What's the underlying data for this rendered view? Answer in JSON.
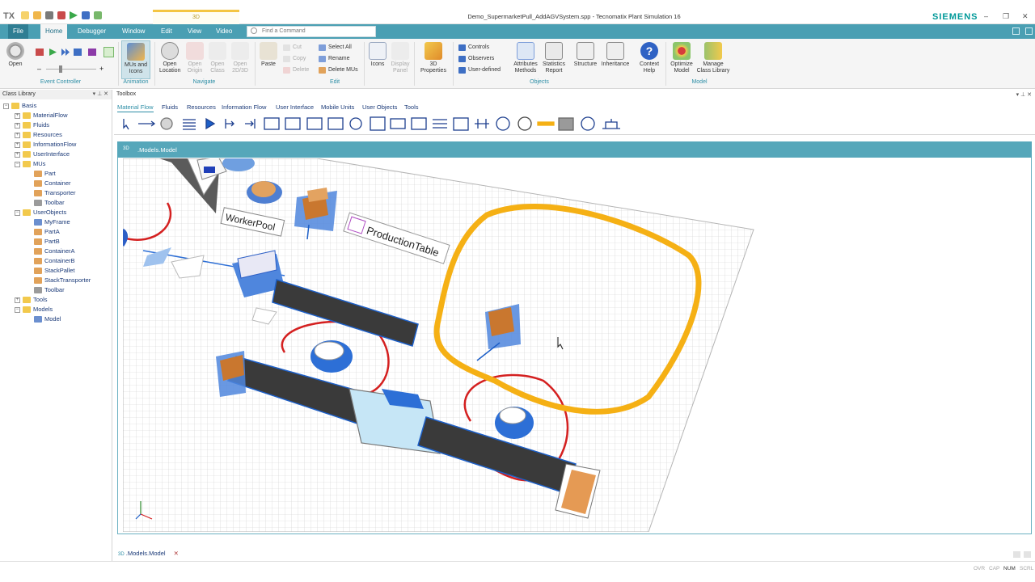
{
  "app": {
    "logo": "TX",
    "context_tab": "3D",
    "window_title": "Demo_SupermarketPull_AddAGVSystem.spp - Tecnomatix Plant Simulation 16",
    "brand": "SIEMENS",
    "minimize": "–",
    "restore": "❐",
    "close": "✕"
  },
  "tabs": [
    "File",
    "Home",
    "Debugger",
    "Window",
    "Edit",
    "View",
    "Video"
  ],
  "command_search": {
    "placeholder": "Find a Command"
  },
  "ribbon": {
    "event_controller": {
      "label": "Event Controller",
      "open": "Open",
      "minus": "–",
      "plus": "+"
    },
    "animation": {
      "label": "Animation",
      "mus_icons": "MUs and Icons"
    },
    "navigate": {
      "label": "Navigate",
      "open_location": "Open Location",
      "open_origin": "Open Origin",
      "open_class": "Open Class",
      "open_2d3d": "Open 2D/3D"
    },
    "edit": {
      "label": "Edit",
      "paste": "Paste",
      "cut": "Cut",
      "copy": "Copy",
      "delete": "Delete",
      "select_all": "Select All",
      "rename": "Rename",
      "delete_mus": "Delete MUs"
    },
    "icons": "Icons",
    "display_panel": "Display Panel",
    "properties_3d": "3D Properties",
    "objects": {
      "label": "Objects",
      "controls": "Controls",
      "observers": "Observers",
      "user_defined": "User-defined",
      "attributes_methods": "Attributes Methods",
      "statistics_report": "Statistics Report",
      "structure": "Structure",
      "inheritance": "Inheritance",
      "context_help": "Context Help"
    },
    "model": {
      "label": "Model",
      "optimize": "Optimize Model",
      "manage": "Manage Class Library"
    }
  },
  "class_library": {
    "title": "Class Library",
    "pin": "▾  ⊥  ✕",
    "items": [
      {
        "label": "Basis",
        "level": 0,
        "kind": "folder",
        "exp": "−"
      },
      {
        "label": "MaterialFlow",
        "level": 1,
        "kind": "folder",
        "exp": "+"
      },
      {
        "label": "Fluids",
        "level": 1,
        "kind": "folder",
        "exp": "+"
      },
      {
        "label": "Resources",
        "level": 1,
        "kind": "folder",
        "exp": "+"
      },
      {
        "label": "InformationFlow",
        "level": 1,
        "kind": "folder",
        "exp": "+"
      },
      {
        "label": "UserInterface",
        "level": 1,
        "kind": "folder",
        "exp": "+"
      },
      {
        "label": "MUs",
        "level": 1,
        "kind": "folder",
        "exp": "−"
      },
      {
        "label": "Part",
        "level": 2,
        "kind": "leaf"
      },
      {
        "label": "Container",
        "level": 2,
        "kind": "leaf"
      },
      {
        "label": "Transporter",
        "level": 2,
        "kind": "leaf"
      },
      {
        "label": "Toolbar",
        "level": 2,
        "kind": "leaf-grey"
      },
      {
        "label": "UserObjects",
        "level": 1,
        "kind": "folder",
        "exp": "−"
      },
      {
        "label": "MyFrame",
        "level": 2,
        "kind": "leaf-blue"
      },
      {
        "label": "PartA",
        "level": 2,
        "kind": "leaf"
      },
      {
        "label": "PartB",
        "level": 2,
        "kind": "leaf"
      },
      {
        "label": "ContainerA",
        "level": 2,
        "kind": "leaf"
      },
      {
        "label": "ContainerB",
        "level": 2,
        "kind": "leaf"
      },
      {
        "label": "StackPallet",
        "level": 2,
        "kind": "leaf"
      },
      {
        "label": "StackTransporter",
        "level": 2,
        "kind": "leaf"
      },
      {
        "label": "Toolbar",
        "level": 2,
        "kind": "leaf-grey"
      },
      {
        "label": "Tools",
        "level": 1,
        "kind": "folder",
        "exp": "+"
      },
      {
        "label": "Models",
        "level": 1,
        "kind": "folder",
        "exp": "−"
      },
      {
        "label": "Model",
        "level": 2,
        "kind": "leaf-blue"
      }
    ]
  },
  "toolbox": {
    "title": "Toolbox",
    "pin": "▾  ⊥  ✕",
    "tabs": [
      "Material Flow",
      "Fluids",
      "Resources",
      "Information Flow",
      "User Interface",
      "Mobile Units",
      "User Objects",
      "Tools"
    ]
  },
  "model_window": {
    "icon": "3D",
    "title": ".Models.Model",
    "labels": {
      "worker_pool": "WorkerPool",
      "production_table": "ProductionTable"
    }
  },
  "doc_tab": {
    "icon": "3D",
    "label": ".Models.Model",
    "close": "✕"
  },
  "status": [
    "OVR",
    "CAP",
    "NUM",
    "SCRL"
  ],
  "colors": {
    "accent": "#4a9fb3",
    "brand": "#009999",
    "track": "#f5b014",
    "conveyor": "#3a3a3a",
    "path": "#d42020"
  }
}
